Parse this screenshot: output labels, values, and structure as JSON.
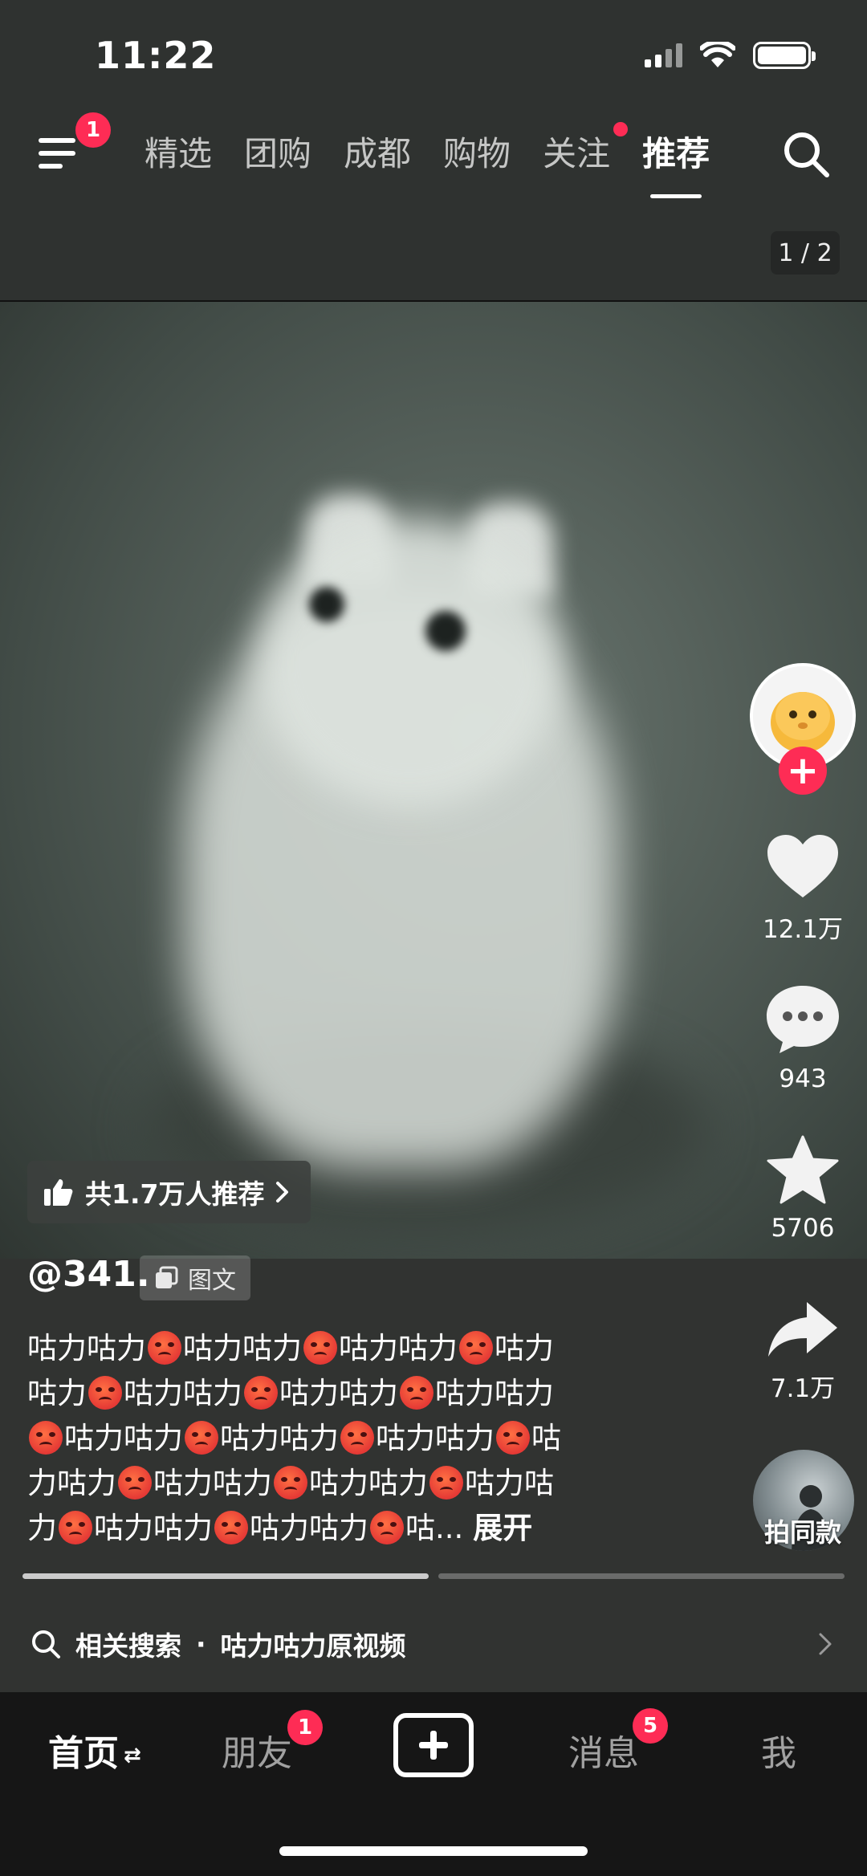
{
  "status_bar": {
    "time": "11:22"
  },
  "top_nav": {
    "menu_badge": "1",
    "tabs": [
      {
        "label": "精选",
        "active": false,
        "dot": false
      },
      {
        "label": "团购",
        "active": false,
        "dot": false
      },
      {
        "label": "成都",
        "active": false,
        "dot": false
      },
      {
        "label": "购物",
        "active": false,
        "dot": false
      },
      {
        "label": "关注",
        "active": false,
        "dot": true
      },
      {
        "label": "推荐",
        "active": true,
        "dot": false
      }
    ]
  },
  "page_indicator": "1 / 2",
  "actions": {
    "likes": "12.1万",
    "comments": "943",
    "favorites": "5706",
    "shares": "7.1万",
    "remix_label": "拍同款"
  },
  "recommend_chip": "共1.7万人推荐",
  "post": {
    "author": "@341.",
    "type_label": "图文",
    "caption_segments": [
      "咕力咕力",
      "咕力咕力",
      "咕力咕力",
      "咕力",
      "咕力",
      "咕力咕力",
      "咕力咕力",
      "咕力咕力",
      "咕力咕力",
      "咕力咕力",
      "咕力咕力",
      "咕",
      "力咕力",
      "咕力咕力",
      "咕力咕力",
      "咕力咕",
      "力",
      "咕力咕力",
      "咕力咕力",
      "咕..."
    ],
    "expand_label": "展开"
  },
  "related_search": {
    "label": "相关搜索",
    "separator": "·",
    "query": "咕力咕力原视频"
  },
  "tab_bar": {
    "home": "首页",
    "home_icon": "⇄",
    "friends": "朋友",
    "friends_badge": "1",
    "messages": "消息",
    "messages_badge": "5",
    "me": "我"
  },
  "colors": {
    "accent": "#fe2c55"
  },
  "icons": {
    "menu": "menu-icon",
    "search": "search-icon",
    "like": "heart-icon",
    "comment": "comment-icon",
    "favorite": "star-icon",
    "share": "share-icon",
    "thumbs_up": "thumbs-up-icon",
    "post_type": "gallery-icon",
    "related": "search-icon",
    "chevron": "chevron-right-icon",
    "create": "plus-icon"
  }
}
